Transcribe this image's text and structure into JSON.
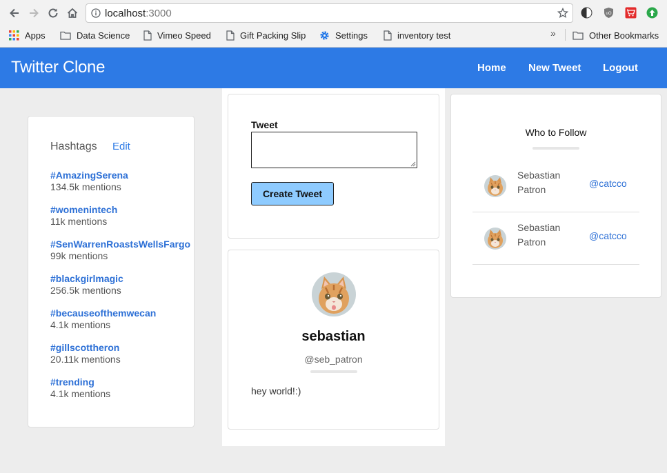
{
  "browser": {
    "url_host": "localhost",
    "url_port": ":3000",
    "bookmarks": [
      {
        "label": "Apps",
        "icon": "apps-grid-icon"
      },
      {
        "label": "Data Science",
        "icon": "folder-icon"
      },
      {
        "label": "Vimeo Speed",
        "icon": "page-icon"
      },
      {
        "label": "Gift Packing Slip",
        "icon": "page-icon"
      },
      {
        "label": "Settings",
        "icon": "gear-icon"
      },
      {
        "label": "inventory test",
        "icon": "page-icon"
      }
    ],
    "more_bookmarks": "»",
    "other_bookmarks": "Other Bookmarks"
  },
  "navbar": {
    "brand": "Twitter Clone",
    "links": [
      "Home",
      "New Tweet",
      "Logout"
    ],
    "color": "#2d7ae5"
  },
  "hashtags": {
    "title": "Hashtags",
    "edit_label": "Edit",
    "items": [
      {
        "tag": "#AmazingSerena",
        "mentions": "134.5k mentions"
      },
      {
        "tag": "#womenintech",
        "mentions": "11k mentions"
      },
      {
        "tag": "#SenWarrenRoastsWellsFargo",
        "mentions": "99k mentions"
      },
      {
        "tag": "#blackgirlmagic",
        "mentions": "256.5k mentions"
      },
      {
        "tag": "#becauseofthemwecan",
        "mentions": "4.1k mentions"
      },
      {
        "tag": "#gillscottheron",
        "mentions": "20.11k mentions"
      },
      {
        "tag": "#trending",
        "mentions": "4.1k mentions"
      }
    ]
  },
  "compose": {
    "label": "Tweet",
    "value": "",
    "button_label": "Create Tweet",
    "button_color": "#8ecbff"
  },
  "profile": {
    "name": "sebastian",
    "handle": "@seb_patron",
    "tweet": "hey world!:)"
  },
  "who_to_follow": {
    "title": "Who to Follow",
    "users": [
      {
        "name": "Sebastian Patron",
        "handle": "@catcco"
      },
      {
        "name": "Sebastian Patron",
        "handle": "@catcco"
      }
    ]
  }
}
